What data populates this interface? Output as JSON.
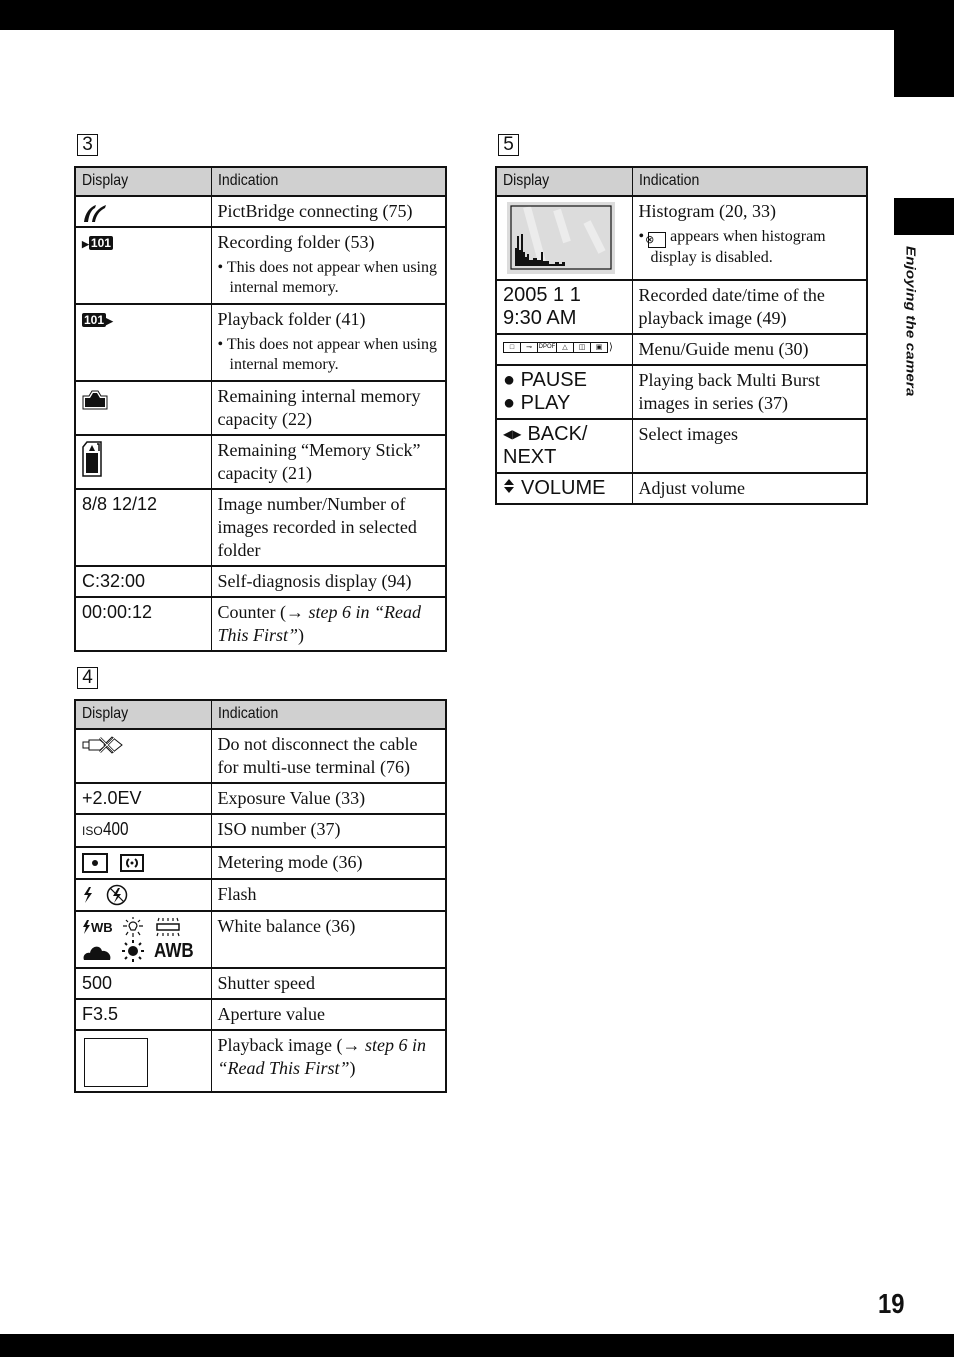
{
  "side_tab": {
    "label": "Enjoying the camera"
  },
  "page_number": "19",
  "sections": {
    "s3": {
      "number": "3",
      "headers": {
        "display": "Display",
        "indication": "Indication"
      },
      "rows": [
        {
          "display_icon": "pictbridge-icon",
          "indication": "PictBridge connecting (75)"
        },
        {
          "display_icon": "recording-folder-icon",
          "display_icon_text": "101",
          "indication": "Recording folder (53)",
          "note": "This does not appear when using internal memory."
        },
        {
          "display_icon": "playback-folder-icon",
          "display_icon_text": "101",
          "indication": "Playback folder (41)",
          "note": "This does not appear when using internal memory."
        },
        {
          "display_icon": "internal-memory-icon",
          "indication": "Remaining internal memory capacity (22)"
        },
        {
          "display_icon": "memory-stick-icon",
          "indication": "Remaining “Memory Stick” capacity (21)"
        },
        {
          "display": "8/8 12/12",
          "indication": "Image number/Number of images recorded in selected folder"
        },
        {
          "display": "C:32:00",
          "indication": "Self-diagnosis display (94)"
        },
        {
          "display": "00:00:12",
          "indication_pre": "Counter (→ ",
          "indication_italic": "step 6 in “Read This First”",
          "indication_post": ")"
        }
      ]
    },
    "s4": {
      "number": "4",
      "headers": {
        "display": "Display",
        "indication": "Indication"
      },
      "rows": [
        {
          "display_icon": "usb-no-disconnect-icon",
          "indication": "Do not disconnect the cable for multi-use terminal (76)"
        },
        {
          "display": "+2.0EV",
          "indication": "Exposure Value (33)"
        },
        {
          "display_prefix": "ISO",
          "display": "400",
          "indication": "ISO number (37)"
        },
        {
          "display_icons": [
            "spot-metering-icon",
            "center-weighted-metering-icon"
          ],
          "indication": "Metering mode (36)"
        },
        {
          "display_icons": [
            "flash-icon",
            "flash-off-icon"
          ],
          "indication": "Flash"
        },
        {
          "display_icons": [
            "flash-wb-icon",
            "incandescent-icon",
            "fluorescent-icon",
            "cloudy-icon",
            "daylight-icon",
            "awb-icon"
          ],
          "wb_flash_text": "WB",
          "awb_text": "AWB",
          "indication": "White balance (36)"
        },
        {
          "display": "500",
          "indication": "Shutter speed"
        },
        {
          "display": "F3.5",
          "indication": "Aperture value"
        },
        {
          "display_icon": "playback-image-frame",
          "indication_pre": "Playback image (→ ",
          "indication_italic": "step 6 in “Read This First”",
          "indication_post": ")"
        }
      ]
    },
    "s5": {
      "number": "5",
      "headers": {
        "display": "Display",
        "indication": "Indication"
      },
      "rows": [
        {
          "display_icon": "histogram-image",
          "indication": "Histogram (20, 33)",
          "note_icon": "histogram-disabled-icon",
          "note": "appears when histogram display is disabled."
        },
        {
          "display_lines": [
            "2005 1 1",
            "9:30 AM"
          ],
          "indication": "Recorded date/time of the playback image (49)"
        },
        {
          "display_icons": [
            "folder-tab-icon",
            "protect-key-tab-icon",
            "dpof-tab-icon",
            "print-tab-icon",
            "slideshow-tab-icon",
            "resize-tab-icon",
            "more-arrow-icon"
          ],
          "dpof_text": "DPOF",
          "indication": "Menu/Guide menu (30)"
        },
        {
          "display_lines": [
            "● PAUSE",
            "● PLAY"
          ],
          "indication": "Playing back Multi Burst images in series (37)"
        },
        {
          "display_arrows": "◀▶",
          "display_lines": [
            "BACK/",
            "NEXT"
          ],
          "indication": "Select images"
        },
        {
          "display_arrows": "⬍",
          "display": "VOLUME",
          "indication": "Adjust volume"
        }
      ]
    }
  }
}
